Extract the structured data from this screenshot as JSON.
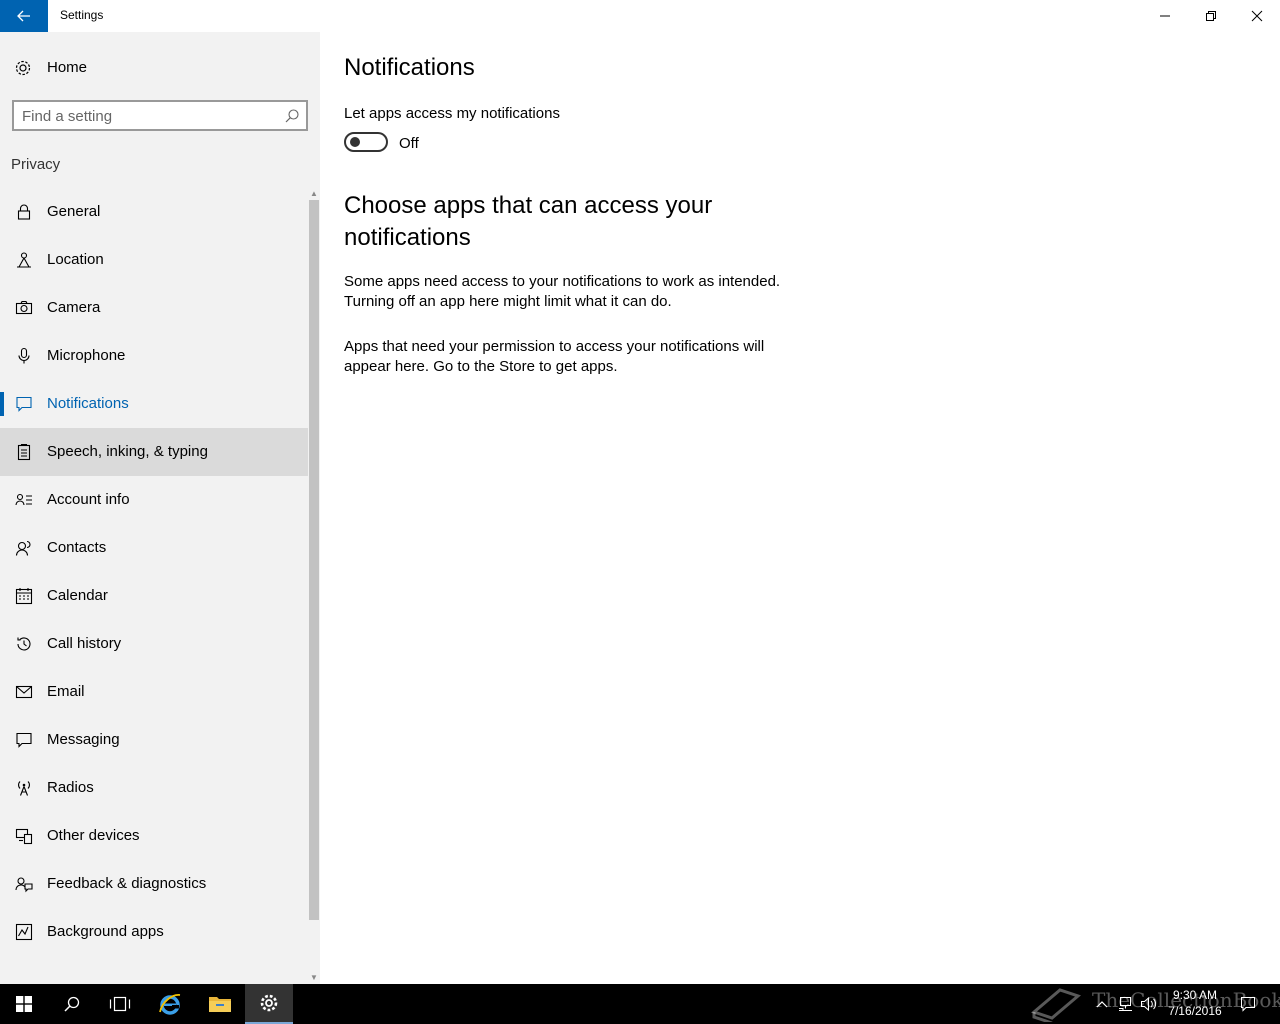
{
  "window": {
    "title": "Settings"
  },
  "sidebar": {
    "home_label": "Home",
    "search_placeholder": "Find a setting",
    "group_label": "Privacy",
    "items": [
      {
        "label": "General"
      },
      {
        "label": "Location"
      },
      {
        "label": "Camera"
      },
      {
        "label": "Microphone"
      },
      {
        "label": "Notifications"
      },
      {
        "label": "Speech, inking, & typing"
      },
      {
        "label": "Account info"
      },
      {
        "label": "Contacts"
      },
      {
        "label": "Calendar"
      },
      {
        "label": "Call history"
      },
      {
        "label": "Email"
      },
      {
        "label": "Messaging"
      },
      {
        "label": "Radios"
      },
      {
        "label": "Other devices"
      },
      {
        "label": "Feedback & diagnostics"
      },
      {
        "label": "Background apps"
      }
    ]
  },
  "main": {
    "title": "Notifications",
    "setting_label": "Let apps access my notifications",
    "toggle_state": "Off",
    "section_title": "Choose apps that can access your notifications",
    "para1": "Some apps need access to your notifications to work as intended. Turning off an app here might limit what it can do.",
    "para2": "Apps that need your permission to access your notifications will appear here. Go to the Store to get apps."
  },
  "taskbar": {
    "time": "9:30 AM",
    "date": "7/16/2016",
    "watermark": "TheCollectionBook"
  },
  "colors": {
    "accent": "#0063b1",
    "sidebar_bg": "#f2f2f2",
    "hover_bg": "#dadada",
    "taskbar_bg": "#000000"
  }
}
